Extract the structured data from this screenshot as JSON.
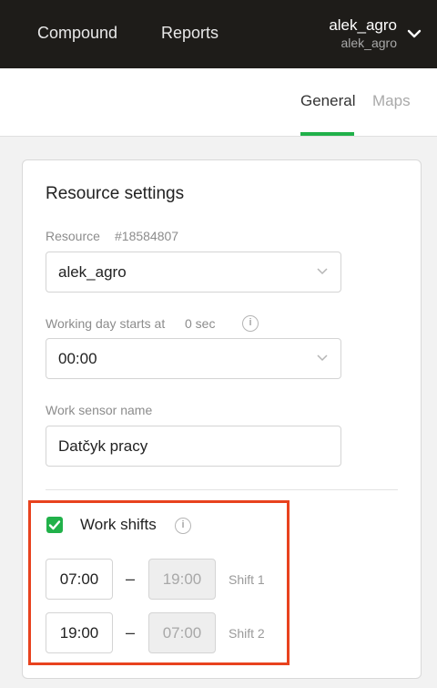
{
  "header": {
    "nav": [
      "Compound",
      "Reports"
    ],
    "user": {
      "name": "alek_agro",
      "account": "alek_agro"
    },
    "icon": "chevron-down-icon"
  },
  "tabs": [
    {
      "label": "General",
      "active": true
    },
    {
      "label": "Maps",
      "active": false
    }
  ],
  "settings": {
    "title": "Resource settings",
    "resource": {
      "label": "Resource",
      "id": "#18584807",
      "selected": "alek_agro"
    },
    "working_day": {
      "label": "Working day starts at",
      "offset": "0 sec",
      "selected": "00:00"
    },
    "sensor": {
      "label": "Work sensor name",
      "value": "Datčyk pracy"
    },
    "work_shifts": {
      "label": "Work shifts",
      "enabled": true,
      "shifts": [
        {
          "start": "07:00",
          "end": "19:00",
          "name": "Shift 1"
        },
        {
          "start": "19:00",
          "end": "07:00",
          "name": "Shift 2"
        }
      ]
    }
  },
  "colors": {
    "accent": "#21b14a",
    "highlight": "#e8421e",
    "topbar": "#1e1c19"
  }
}
